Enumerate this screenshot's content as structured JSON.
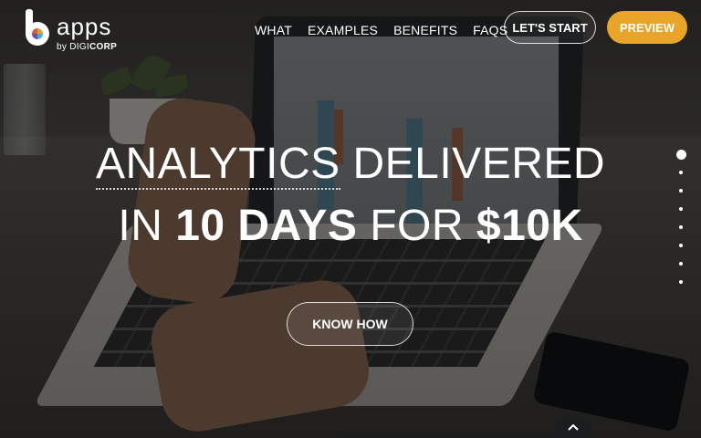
{
  "brand": {
    "name": "apps",
    "by_prefix": "by DIGI",
    "by_bold": "CORP"
  },
  "nav": {
    "items": [
      "WHAT",
      "EXAMPLES",
      "BENEFITS",
      "FAQS"
    ],
    "start_label": "LET'S START",
    "preview_label": "PREVIEW"
  },
  "hero": {
    "line1_abbr": "ANALYTICS",
    "line1_rest": " DELIVERED",
    "line2_in": "IN ",
    "line2_days": "10 DAYS",
    "line2_for": " FOR ",
    "line2_price": "$10K",
    "cta_label": "KNOW HOW"
  },
  "pager": {
    "dot_count": 8,
    "active_index": 0
  },
  "colors": {
    "accent": "#e8a52a",
    "text": "#ffffff",
    "overlay": "rgba(0,0,0,0.45)"
  },
  "icons": {
    "scroll_top": "chevron-up-icon"
  }
}
